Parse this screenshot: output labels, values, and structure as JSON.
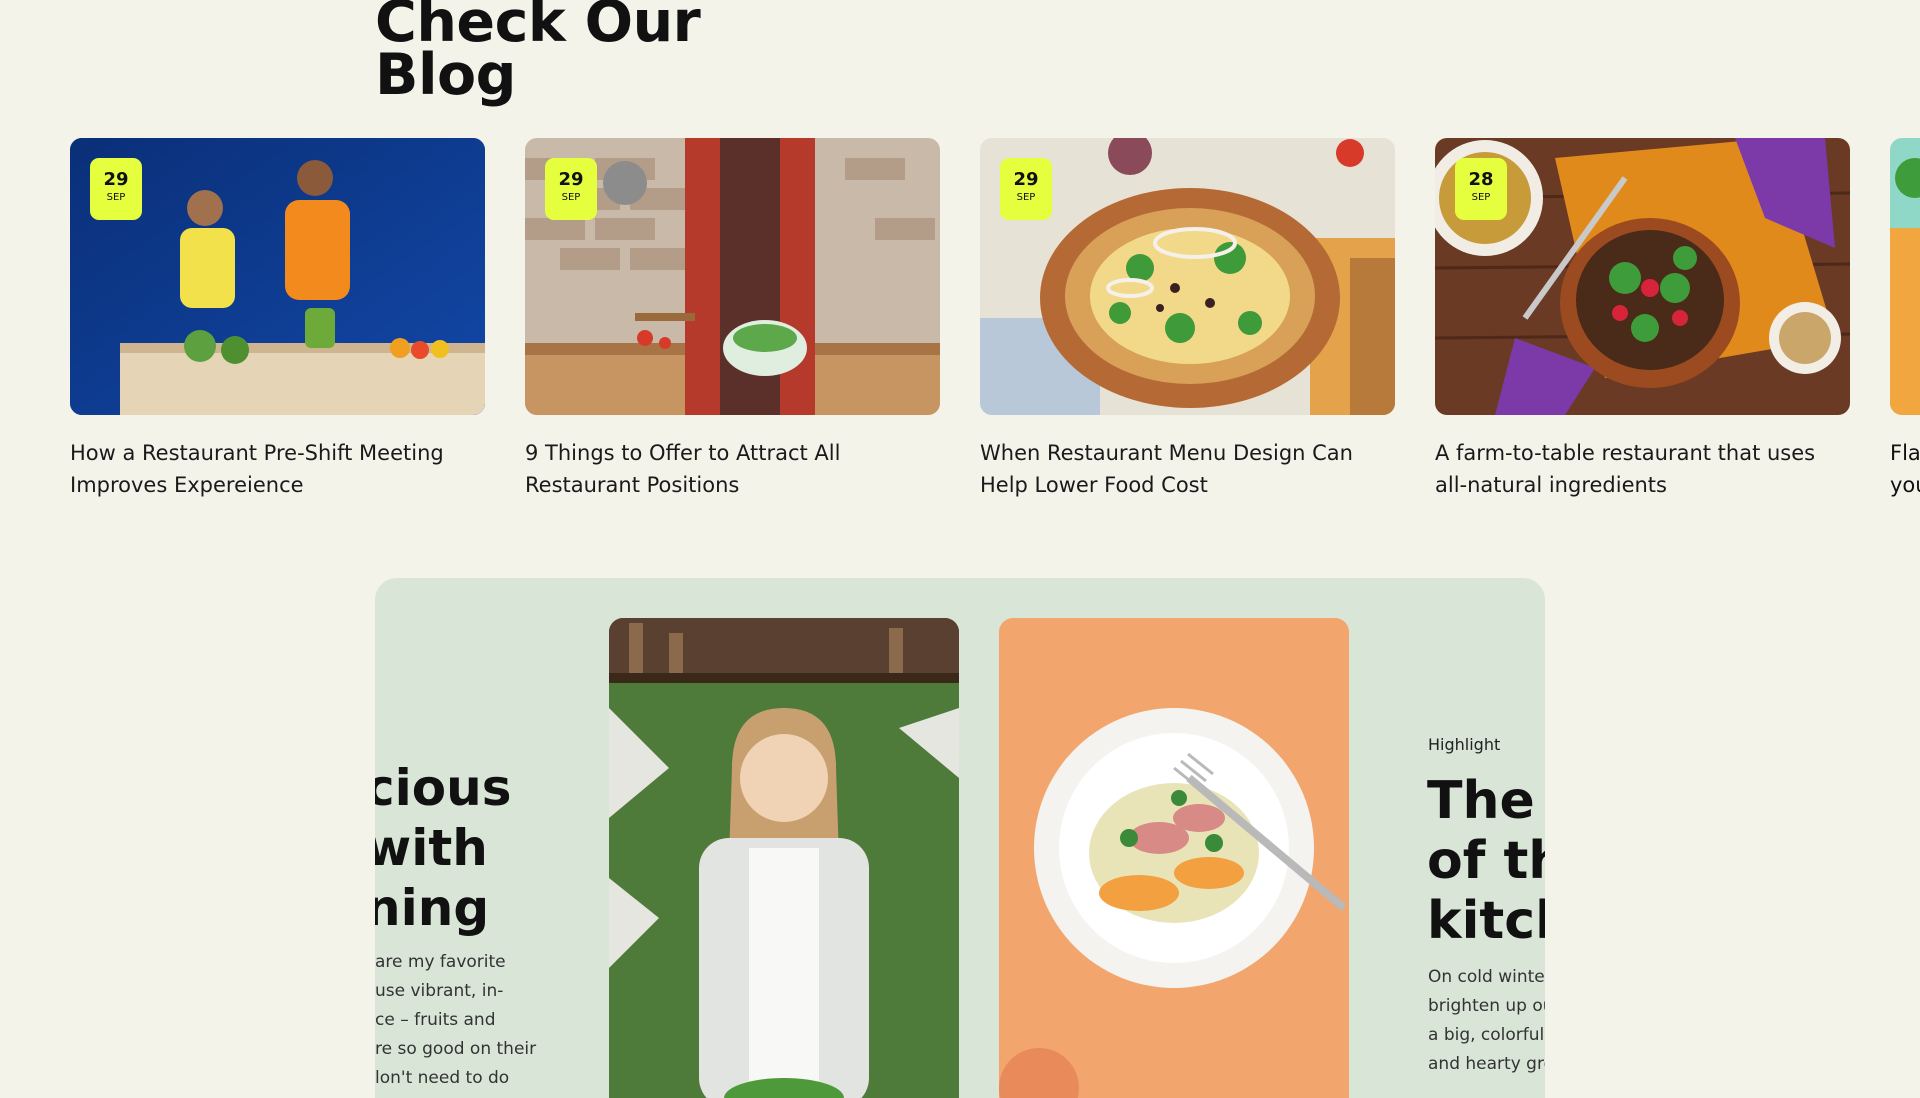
{
  "blog": {
    "heading_line1": "Check Our",
    "heading_line2": "Blog",
    "posts": [
      {
        "day": "29",
        "month": "SEP",
        "title": "How a Restaurant Pre-Shift Meeting Improves Expereience"
      },
      {
        "day": "29",
        "month": "SEP",
        "title": "9 Things to Offer to Attract All Restaurant Positions"
      },
      {
        "day": "29",
        "month": "SEP",
        "title": "When Restaurant Menu Design Can Help Lower Food Cost"
      },
      {
        "day": "28",
        "month": "SEP",
        "title": "A farm-to-table restaurant that uses all-natural ingredients"
      }
    ],
    "partial_post_title_line1": "Fla",
    "partial_post_title_line2": "you"
  },
  "feature": {
    "left_heading": [
      "cious",
      " with",
      "ning"
    ],
    "left_body": [
      "are my favorite",
      "use vibrant, in-",
      "ce – fruits and",
      "re so good on their",
      "lon't need to do"
    ],
    "highlight_label": "Highlight",
    "right_heading": [
      "The r",
      "of th",
      "kitch"
    ],
    "right_body": [
      "On cold winter",
      "brighten up ou",
      "a big, colorful r",
      "and hearty gre"
    ]
  },
  "colors": {
    "background": "#f3f3ea",
    "badge": "#e5ff3f",
    "panel": "#d8e5d7"
  },
  "icons": [
    "calendar-badge"
  ]
}
